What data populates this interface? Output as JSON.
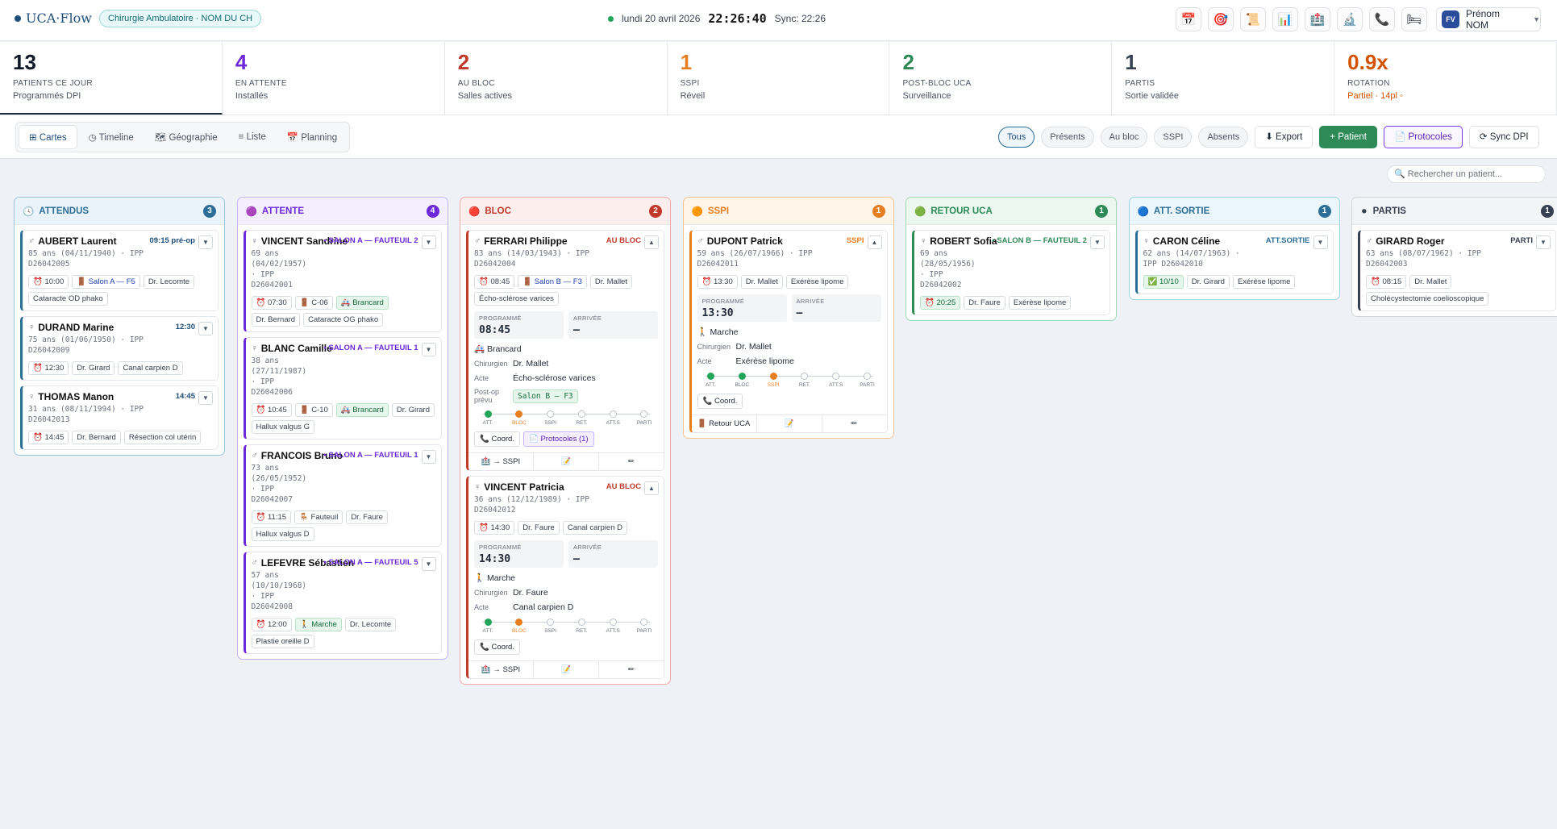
{
  "header": {
    "brand": "UCA·Flow",
    "hospital": "Chirurgie Ambulatoire · NOM DU CH",
    "date": "lundi 20 avril 2026",
    "time": "22:26:40",
    "sync": "Sync: 22:26",
    "user_initials": "FV",
    "user_name": "Prénom NOM",
    "icons": [
      "calendar-icon",
      "target-icon",
      "scroll-icon",
      "bar-chart-icon",
      "hospital-icon",
      "microscope-icon",
      "phone-icon",
      "bed-icon"
    ],
    "icon_glyphs": [
      "📅",
      "🎯",
      "📜",
      "📊",
      "🏥",
      "🔬",
      "📞",
      "🛏"
    ]
  },
  "kpis": [
    {
      "num": "13",
      "label": "PATIENTS CE JOUR",
      "sub": "Programmés DPI",
      "color": "#111827"
    },
    {
      "num": "4",
      "label": "EN ATTENTE",
      "sub": "Installés",
      "color": "#6d28d9"
    },
    {
      "num": "2",
      "label": "AU BLOC",
      "sub": "Salles actives",
      "color": "#c0392b"
    },
    {
      "num": "1",
      "label": "SSPI",
      "sub": "Réveil",
      "color": "#e67e22"
    },
    {
      "num": "2",
      "label": "POST-BLOC UCA",
      "sub": "Surveillance",
      "color": "#2e8b57"
    },
    {
      "num": "1",
      "label": "PARTIS",
      "sub": "Sortie validée",
      "color": "#374151"
    },
    {
      "num": "0.9x",
      "label": "ROTATION",
      "sub": "Partiel · 14pl ◦",
      "color": "#d35400"
    }
  ],
  "views": [
    "⊞ Cartes",
    "◷ Timeline",
    "🗺 Géographie",
    "≡ Liste",
    "📅 Planning"
  ],
  "filters": [
    "Tous",
    "Présents",
    "Au bloc",
    "SSPI",
    "Absents"
  ],
  "actions": {
    "export": "⬇ Export",
    "patient": "+ Patient",
    "protocoles": "📄 Protocoles",
    "sync": "⟳ Sync DPI"
  },
  "search_placeholder": "🔍  Rechercher un patient...",
  "steps": [
    "ATT.",
    "BLOC",
    "SSPI",
    "RET.",
    "ATT.S",
    "PARTI"
  ],
  "columns": [
    {
      "title": "ATTENDUS",
      "count": "3",
      "icon": "🕓",
      "color": "#2c6e96",
      "bg": "#eaf3fa",
      "border": "#9cc4df",
      "cards": [
        {
          "name": "AUBERT Laurent",
          "sex": "♂",
          "meta": [
            "85 ans (04/11/1940) · IPP",
            "D26042005"
          ],
          "badge": "09:15 pré-op",
          "badge_color": "#1f4e79",
          "chips": [
            "⏰ 10:00",
            "🚪 Salon A — F5",
            "Dr. Lecomte",
            "Cataracte OD phako"
          ]
        },
        {
          "name": "DURAND Marine",
          "sex": "♀",
          "meta": [
            "75 ans (01/06/1950) · IPP",
            "D26042009"
          ],
          "badge": "12:30",
          "badge_color": "#1f4e79",
          "chips": [
            "⏰ 12:30",
            "Dr. Girard",
            "Canal carpien D"
          ]
        },
        {
          "name": "THOMAS Manon",
          "sex": "♀",
          "meta": [
            "31 ans (08/11/1994) · IPP",
            "D26042013"
          ],
          "badge": "14:45",
          "badge_color": "#1f4e79",
          "chips": [
            "⏰ 14:45",
            "Dr. Bernard",
            "Résection col utérin"
          ]
        }
      ]
    },
    {
      "title": "ATTENTE",
      "count": "4",
      "icon": "🟣",
      "color": "#6d28d9",
      "bg": "#f3efff",
      "border": "#c4b5fd",
      "cards": [
        {
          "name": "VINCENT Sandrine",
          "sex": "♀",
          "meta": [
            "69 ans",
            "(04/02/1957)",
            "· IPP",
            "D26042001"
          ],
          "badge": "• SALON A — FAUTEUIL 2",
          "badge_color": "#6d28d9",
          "chips": [
            "⏰ 07:30",
            "🚪 C-06",
            "🚑 Brancard",
            "Dr. Bernard",
            "Cataracte OG phako"
          ]
        },
        {
          "name": "BLANC Camille",
          "sex": "♀",
          "meta": [
            "38 ans",
            "(27/11/1987)",
            "· IPP",
            "D26042006"
          ],
          "badge": "• SALON A — FAUTEUIL 1",
          "badge_color": "#6d28d9",
          "chips": [
            "⏰ 10:45",
            "🚪 C-10",
            "🚑 Brancard",
            "Dr. Girard",
            "Hallux valgus G"
          ]
        },
        {
          "name": "FRANCOIS Bruno",
          "sex": "♂",
          "meta": [
            "73 ans",
            "(26/05/1952)",
            "· IPP",
            "D26042007"
          ],
          "badge": "• SALON A — FAUTEUIL 1",
          "badge_color": "#6d28d9",
          "chips": [
            "⏰ 11:15",
            "🪑 Fauteuil",
            "Dr. Faure",
            "Hallux valgus D"
          ]
        },
        {
          "name": "LEFEVRE Sébastien",
          "sex": "♂",
          "meta": [
            "57 ans",
            "(10/10/1968)",
            "· IPP",
            "D26042008"
          ],
          "badge": "• SALON A — FAUTEUIL 5",
          "badge_color": "#6d28d9",
          "chips": [
            "⏰ 12:00",
            "🚶 Marche",
            "Dr. Lecomte",
            "Plastie oreille D"
          ]
        }
      ]
    },
    {
      "title": "BLOC",
      "count": "2",
      "icon": "🔴",
      "color": "#c0392b",
      "bg": "#fdeeee",
      "border": "#f2aaa6",
      "cards": [
        {
          "name": "FERRARI Philippe",
          "sex": "♂",
          "meta": [
            "83 ans (14/03/1943) · IPP",
            "D26042004"
          ],
          "badge": "AU BLOC",
          "badge_color": "#c0392b",
          "chips": [
            "⏰ 08:45",
            "🚪 Salon B — F3",
            "Dr. Mallet",
            "Écho-sclérose varices"
          ],
          "prog": "08:45",
          "arr": "—",
          "trans": "🚑 Brancard",
          "surgeon": "Dr. Mallet",
          "act": "Écho-sclérose varices",
          "postop": "Salon B — F3",
          "step": 1,
          "protocol": "📄 Protocoles (1)",
          "foot": [
            "🏥 → SSPI",
            "📝",
            "✏"
          ]
        },
        {
          "name": "VINCENT Patricia",
          "sex": "♀",
          "meta": [
            "36 ans (12/12/1989) · IPP",
            "D26042012"
          ],
          "badge": "AU BLOC",
          "badge_color": "#c0392b",
          "chips": [
            "⏰ 14:30",
            "Dr. Faure",
            "Canal carpien D"
          ],
          "prog": "14:30",
          "arr": "—",
          "trans": "🚶 Marche",
          "surgeon": "Dr. Faure",
          "act": "Canal carpien D",
          "step": 1,
          "foot": [
            "🏥 → SSPI",
            "📝",
            "✏"
          ]
        }
      ]
    },
    {
      "title": "SSPI",
      "count": "1",
      "icon": "🟠",
      "color": "#e67e22",
      "bg": "#fef4e8",
      "border": "#f5c48f",
      "cards": [
        {
          "name": "DUPONT Patrick",
          "sex": "♂",
          "meta": [
            "59 ans (26/07/1966) · IPP",
            "D26042011"
          ],
          "badge": "SSPI",
          "badge_color": "#e67e22",
          "chips": [
            "⏰ 13:30",
            "Dr. Mallet",
            "Exérèse lipome"
          ],
          "prog": "13:30",
          "arr": "—",
          "trans": "🚶 Marche",
          "surgeon": "Dr. Mallet",
          "act": "Exérèse lipome",
          "step": 2,
          "foot": [
            "🚪 Retour UCA",
            "📝",
            "✏"
          ]
        }
      ]
    },
    {
      "title": "RETOUR UCA",
      "count": "1",
      "icon": "🟢",
      "color": "#2e8b57",
      "bg": "#ebf7ef",
      "border": "#9fd9b4",
      "cards": [
        {
          "name": "ROBERT Sofia",
          "sex": "♀",
          "meta": [
            "69 ans",
            "(28/05/1956)",
            "· IPP",
            "D26042002"
          ],
          "badge": "• SALON B — FAUTEUIL 2",
          "badge_color": "#2e8b57",
          "chips": [
            "⏰ 20:25",
            "Dr. Faure",
            "Exérèse lipome"
          ]
        }
      ]
    },
    {
      "title": "ATT. SORTIE",
      "count": "1",
      "icon": "🔵",
      "color": "#2c6e96",
      "bg": "#eaf6fb",
      "border": "#9dd3e6",
      "cards": [
        {
          "name": "CARON Céline",
          "sex": "♀",
          "meta": [
            "62 ans (14/07/1963) ·",
            "IPP D26042010"
          ],
          "badge": "ATT.SORTIE",
          "badge_color": "#2c6e96",
          "chips": [
            "✅ 10/10",
            "Dr. Girard",
            "Exérèse lipome"
          ]
        }
      ]
    },
    {
      "title": "PARTIS",
      "count": "1",
      "icon": "⚫",
      "color": "#374151",
      "bg": "#f3f4f6",
      "border": "#d1d5db",
      "cards": [
        {
          "name": "GIRARD Roger",
          "sex": "♂",
          "meta": [
            "63 ans (08/07/1962) · IPP",
            "D26042003"
          ],
          "badge": "PARTI",
          "badge_color": "#374151",
          "chips": [
            "⏰ 08:15",
            "Dr. Mallet",
            "Cholécystectomie coelioscopique"
          ]
        }
      ]
    }
  ],
  "labels": {
    "programme": "PROGRAMMÉ",
    "arrivee": "ARRIVÉE",
    "chirurgien": "Chirurgien",
    "acte": "Acte",
    "postop": "Post-op prévu",
    "coord": "📞 Coord."
  }
}
